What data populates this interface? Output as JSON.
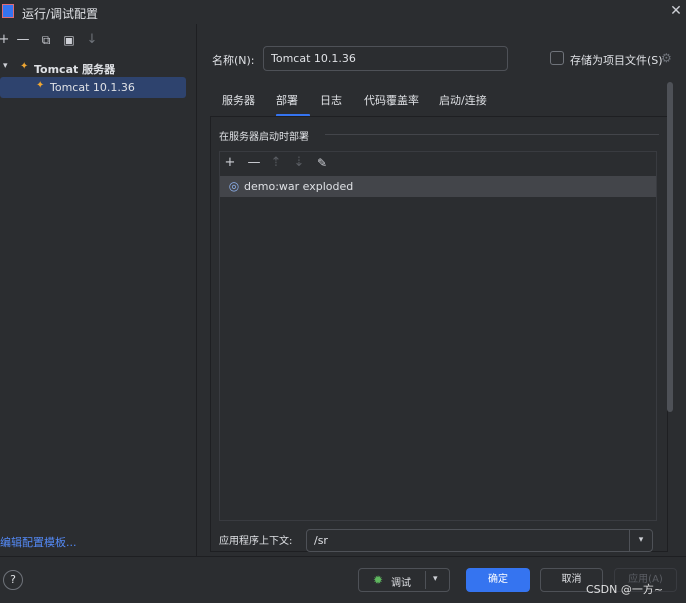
{
  "window": {
    "title": "运行/调试配置",
    "app_icon": "intellij-icon",
    "close_glyph": "✕"
  },
  "left_toolbar": {
    "add_glyph": "+",
    "remove_glyph": "—",
    "copy_glyph": "⧉",
    "folder_glyph": "▣",
    "sort_glyph": "↓"
  },
  "tree": {
    "parent_label": "Tomcat 服务器",
    "child_label": "Tomcat 10.1.36",
    "expanded_glyph": "▾",
    "icon_glyph": "✦"
  },
  "edit_templates": "编辑配置模板...",
  "form": {
    "name_label": "名称(N):",
    "name_value": "Tomcat 10.1.36",
    "store_label": "存储为项目文件(S)",
    "store_checked": false
  },
  "tabs": [
    "服务器",
    "部署",
    "日志",
    "代码覆盖率",
    "启动/连接"
  ],
  "active_tab": "部署",
  "deploy": {
    "section_title": "在服务器启动时部署",
    "toolbar": {
      "add": "+",
      "remove": "—",
      "up": "⇡",
      "down": "⇣",
      "edit": "✎"
    },
    "items": [
      "demo:war exploded"
    ],
    "context_label": "应用程序上下文:",
    "context_value": "/sr"
  },
  "footer": {
    "help": "?",
    "debug_label": "调试",
    "ok_label": "确定",
    "cancel_label": "取消",
    "apply_label": "应用(A)",
    "watermark": "CSDN @一方~"
  },
  "colors": {
    "background": "#2b2d30",
    "accent": "#3574f0",
    "selection": "#2e436e",
    "link": "#548af7"
  }
}
